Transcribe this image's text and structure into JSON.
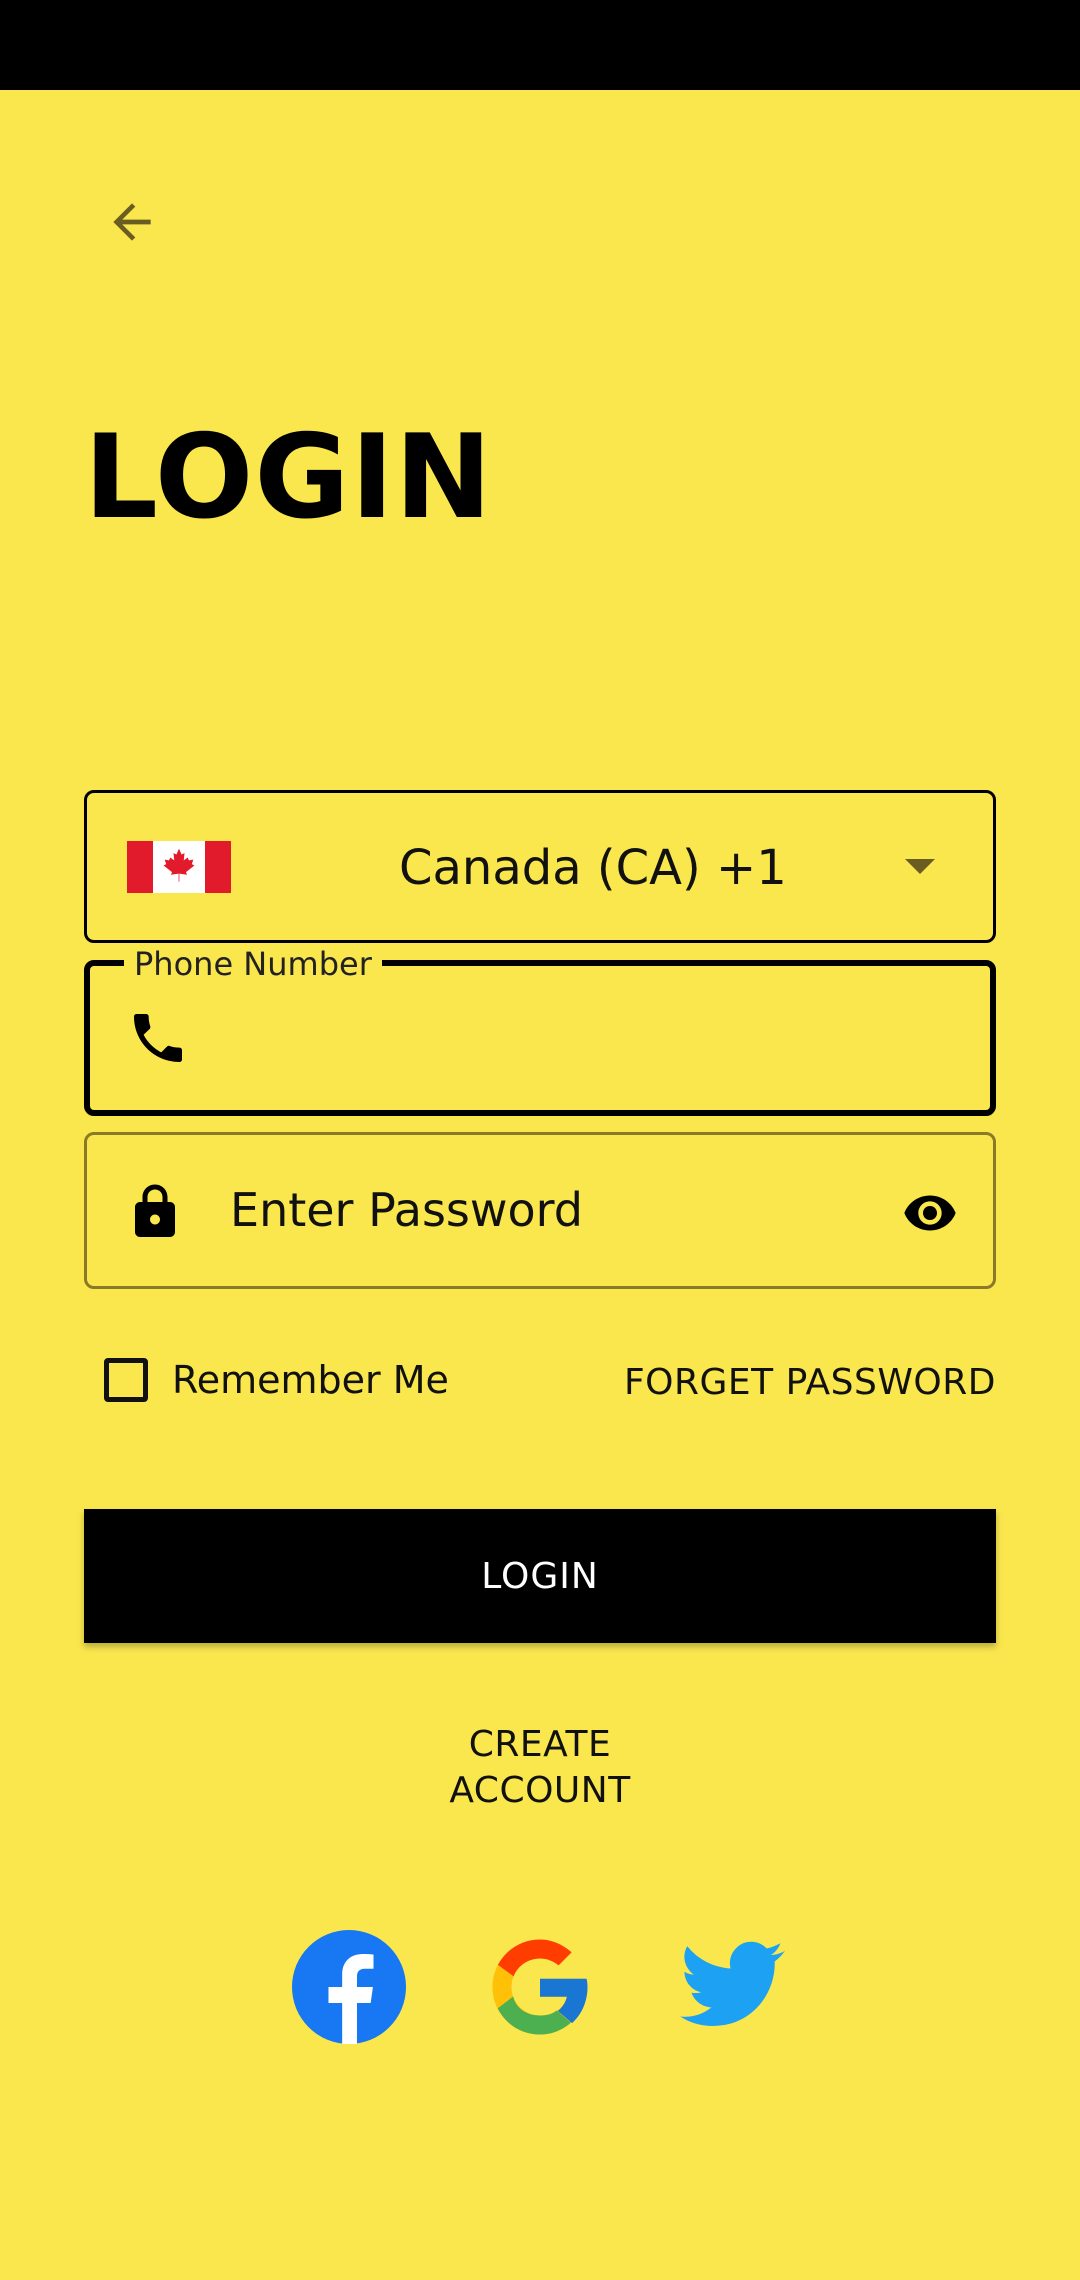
{
  "header": {
    "title": "LOGIN"
  },
  "country_select": {
    "flag": "canada-flag",
    "label": "Canada (CA)  +1"
  },
  "phone": {
    "label": "Phone Number",
    "value": ""
  },
  "password": {
    "placeholder": "Enter Password"
  },
  "remember": {
    "label": "Remember Me",
    "checked": false
  },
  "forget_label": "FORGET PASSWORD",
  "login_button_label": "LOGIN",
  "create_account": {
    "line1": "CREATE",
    "line2": "ACCOUNT"
  },
  "social": [
    "facebook-icon",
    "google-icon",
    "twitter-icon"
  ],
  "colors": {
    "background": "#FAE64D",
    "button": "#000000",
    "accent_red": "#E21B2C"
  }
}
